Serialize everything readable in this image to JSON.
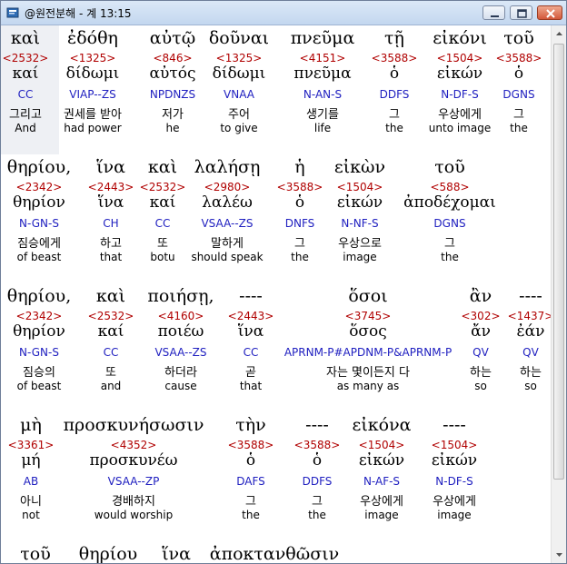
{
  "window": {
    "title": "@원전분해 - 계 13:15"
  },
  "blocks": [
    {
      "cells": [
        {
          "greek": "καὶ",
          "num": "<2532>",
          "lemma": "καί",
          "parse": "CC",
          "korean": "그리고",
          "english": "And"
        },
        {
          "greek": "ἐδόθη",
          "num": "<1325>",
          "lemma": "δίδωμι",
          "parse": "VIAP--ZS",
          "korean": "권세를 받아",
          "english": "had power"
        },
        {
          "greek": "αὐτῷ",
          "num": "<846>",
          "lemma": "αὐτός",
          "parse": "NPDNZS",
          "korean": "저가",
          "english": "he"
        },
        {
          "greek": "δοῦναι",
          "num": "<1325>",
          "lemma": "δίδωμι",
          "parse": "VNAA",
          "korean": "주어",
          "english": "to give"
        },
        {
          "greek": "πνεῦμα",
          "num": "<4151>",
          "lemma": "πνεῦμα",
          "parse": "N-AN-S",
          "korean": "생기를",
          "english": "life"
        },
        {
          "greek": "τῇ",
          "num": "<3588>",
          "lemma": "ὁ",
          "parse": "DDFS",
          "korean": "그",
          "english": "the"
        },
        {
          "greek": "εἰκόνι",
          "num": "<1504>",
          "lemma": "εἰκών",
          "parse": "N-DF-S",
          "korean": "우상에게",
          "english": "unto image"
        },
        {
          "greek": "τοῦ",
          "num": "<3588>",
          "lemma": "ὁ",
          "parse": "DGNS",
          "korean": "그",
          "english": "the"
        }
      ]
    },
    {
      "cells": [
        {
          "greek": "θηρίου,",
          "num": "<2342>",
          "lemma": "θηρίον",
          "parse": "N-GN-S",
          "korean": "짐승에게",
          "english": "of beast"
        },
        {
          "greek": "ἵνα",
          "num": "<2443>",
          "lemma": "ἵνα",
          "parse": "CH",
          "korean": "하고",
          "english": "that"
        },
        {
          "greek": "καὶ",
          "num": "<2532>",
          "lemma": "καί",
          "parse": "CC",
          "korean": "또",
          "english": "botu"
        },
        {
          "greek": "λαλήσῃ",
          "num": "<2980>",
          "lemma": "λαλέω",
          "parse": "VSAA--ZS",
          "korean": "말하게",
          "english": "should speak"
        },
        {
          "greek": "ἡ",
          "num": "<3588>",
          "lemma": "ὁ",
          "parse": "DNFS",
          "korean": "그",
          "english": "the"
        },
        {
          "greek": "εἰκὼν",
          "num": "<1504>",
          "lemma": "εἰκών",
          "parse": "N-NF-S",
          "korean": "우상으로",
          "english": "image"
        },
        {
          "greek": "τοῦ",
          "num": "<588>",
          "lemma": "ἀποδέχομαι",
          "parse": "DGNS",
          "korean": "그",
          "english": "the"
        }
      ]
    },
    {
      "cells": [
        {
          "greek": "θηρίου,",
          "num": "<2342>",
          "lemma": "θηρίον",
          "parse": "N-GN-S",
          "korean": "짐승의",
          "english": "of beast"
        },
        {
          "greek": "καὶ",
          "num": "<2532>",
          "lemma": "καί",
          "parse": "CC",
          "korean": "또",
          "english": "and"
        },
        {
          "greek": "ποιήσῃ,",
          "num": "<4160>",
          "lemma": "ποιέω",
          "parse": "VSAA--ZS",
          "korean": "하더라",
          "english": "cause"
        },
        {
          "greek": "----",
          "num": "<2443>",
          "lemma": "ἵνα",
          "parse": "CC",
          "korean": "곧",
          "english": "that"
        },
        {
          "greek": "ὅσοι",
          "num": "<3745>",
          "lemma": "ὅσος",
          "parse": "APRNM-P#APDNM-P&APRNM-P",
          "korean": "자는 몇이든지 다",
          "english": "as many as"
        },
        {
          "greek": "ἂν",
          "num": "<302>",
          "lemma": "ἄν",
          "parse": "QV",
          "korean": "하는",
          "english": "so"
        },
        {
          "greek": "----",
          "num": "<1437>",
          "lemma": "ἐάν",
          "parse": "QV",
          "korean": "하는",
          "english": "so"
        }
      ]
    },
    {
      "cells": [
        {
          "greek": "μὴ",
          "num": "<3361>",
          "lemma": "μή",
          "parse": "AB",
          "korean": "아니",
          "english": "not"
        },
        {
          "greek": "προσκυνήσωσιν",
          "num": "<4352>",
          "lemma": "προσκυνέω",
          "parse": "VSAA--ZP",
          "korean": "경배하지",
          "english": "would worship"
        },
        {
          "greek": "τὴν",
          "num": "<3588>",
          "lemma": "ὁ",
          "parse": "DAFS",
          "korean": "그",
          "english": "the"
        },
        {
          "greek": "----",
          "num": "<3588>",
          "lemma": "ὁ",
          "parse": "DDFS",
          "korean": "그",
          "english": "the"
        },
        {
          "greek": "εἰκόνα",
          "num": "<1504>",
          "lemma": "εἰκών",
          "parse": "N-AF-S",
          "korean": "우상에게",
          "english": "image"
        },
        {
          "greek": "----",
          "num": "<1504>",
          "lemma": "εἰκών",
          "parse": "N-DF-S",
          "korean": "우상에게",
          "english": "image"
        }
      ]
    },
    {
      "cells": [
        {
          "greek": "τοῦ"
        },
        {
          "greek": "θηρίου"
        },
        {
          "greek": "ἵνα"
        },
        {
          "greek": "ἀποκτανθῶσιν"
        }
      ]
    }
  ]
}
